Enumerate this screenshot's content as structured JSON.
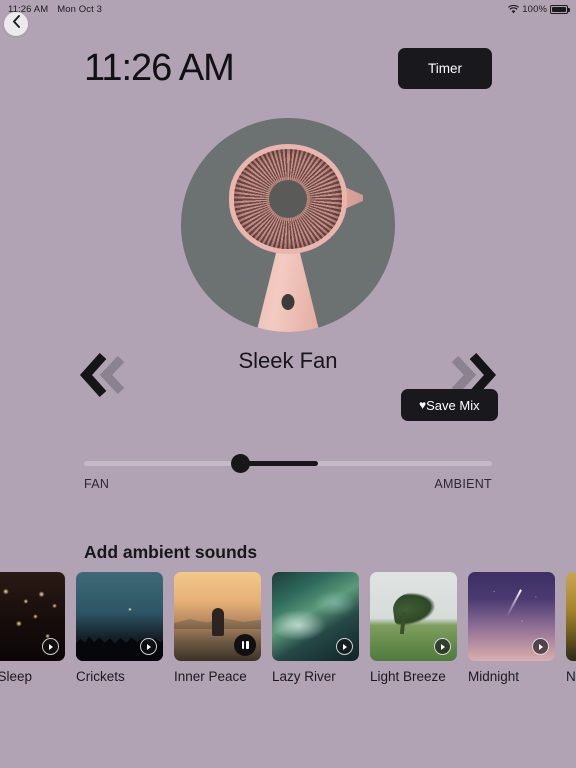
{
  "statusbar": {
    "time": "11:26 AM",
    "date": "Mon Oct 3",
    "battery_percent": "100%",
    "wifi_icon": "wifi-icon",
    "battery_icon": "battery-full-icon"
  },
  "nav": {
    "back_icon": "chevron-left-icon",
    "prev_icon": "double-chevron-left-icon",
    "next_icon": "double-chevron-right-icon"
  },
  "header": {
    "clock": "11:26 AM",
    "timer_label": "Timer"
  },
  "hero": {
    "sound_title": "Sleek Fan",
    "image_alt": "pink-desk-fan"
  },
  "save_mix": {
    "label": "Save Mix",
    "heart_icon": "♥"
  },
  "slider": {
    "left_label": "FAN",
    "right_label": "AMBIENT",
    "value_percent": 38,
    "fill_end_percent": 57
  },
  "ambient": {
    "section_title": "Add ambient sounds",
    "cards": [
      {
        "label": "ter Sleep",
        "art": "art-candles",
        "state": "play",
        "icon": "play-icon"
      },
      {
        "label": "Crickets",
        "art": "art-crickets",
        "state": "play",
        "icon": "play-icon"
      },
      {
        "label": "Inner Peace",
        "art": "art-innerpeace",
        "state": "pause",
        "icon": "pause-icon"
      },
      {
        "label": "Lazy River",
        "art": "art-lazyriver",
        "state": "play",
        "icon": "play-icon"
      },
      {
        "label": "Light Breeze",
        "art": "art-lightbreeze",
        "state": "play",
        "icon": "play-icon"
      },
      {
        "label": "Midnight",
        "art": "art-midnight",
        "state": "play",
        "icon": "play-icon"
      },
      {
        "label": "N",
        "art": "art-night",
        "state": "play",
        "icon": "play-icon"
      }
    ]
  },
  "colors": {
    "background": "#b2a3b4",
    "accent_dark": "#19181c",
    "hero_circle": "#6c7272",
    "track": "#c4bac6"
  }
}
